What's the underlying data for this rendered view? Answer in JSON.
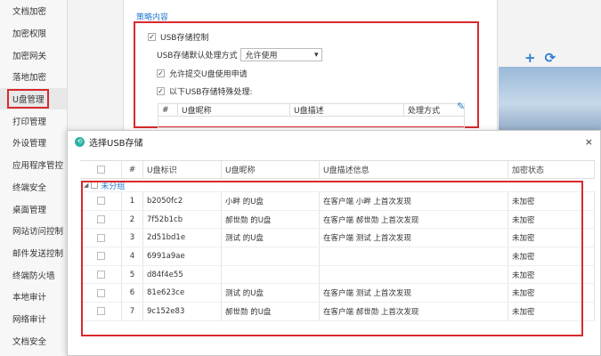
{
  "sidebar": {
    "items": [
      {
        "label": "文档加密"
      },
      {
        "label": "加密权限"
      },
      {
        "label": "加密网关"
      },
      {
        "label": "落地加密"
      },
      {
        "label": "U盘管理"
      },
      {
        "label": "打印管理"
      },
      {
        "label": "外设管理"
      },
      {
        "label": "应用程序管控"
      },
      {
        "label": "终端安全"
      },
      {
        "label": "桌面管理"
      },
      {
        "label": "网站访问控制"
      },
      {
        "label": "邮件发送控制"
      },
      {
        "label": "终端防火墙"
      },
      {
        "label": "本地审计"
      },
      {
        "label": "网络审计"
      },
      {
        "label": "文档安全"
      }
    ],
    "active_index": 4
  },
  "policy": {
    "section_title": "策略内容",
    "usb_control_label": "USB存储控制",
    "default_mode_label": "USB存储默认处理方式",
    "default_mode_value": "允许使用",
    "allow_request_label": "允许提交U盘使用申请",
    "special_label": "以下USB存储特殊处理:",
    "table_headers": [
      "#",
      "U盘昵称",
      "U盘描述",
      "处理方式"
    ]
  },
  "dialog": {
    "title": "选择USB存储",
    "close_glyph": "×",
    "headers": [
      "#",
      "U盘标识",
      "U盘昵称",
      "U盘描述信息",
      "加密状态"
    ],
    "group_label": "未分组",
    "rows": [
      {
        "num": "1",
        "id": "b2050fc2",
        "nick": "小畔 的U盘",
        "desc": "在客户端 小畔 上首次发现",
        "status": "未加密"
      },
      {
        "num": "2",
        "id": "7f52b1cb",
        "nick": "郝世勋 的U盘",
        "desc": "在客户端 郝世勋 上首次发现",
        "status": "未加密"
      },
      {
        "num": "3",
        "id": "2d51bd1e",
        "nick": "测试 的U盘",
        "desc": "在客户端 测试 上首次发现",
        "status": "未加密"
      },
      {
        "num": "4",
        "id": "6991a9ae",
        "nick": "",
        "desc": "",
        "status": "未加密"
      },
      {
        "num": "5",
        "id": "d84f4e55",
        "nick": "",
        "desc": "",
        "status": "未加密"
      },
      {
        "num": "6",
        "id": "81e623ce",
        "nick": "测试 的U盘",
        "desc": "在客户端 测试 上首次发现",
        "status": "未加密"
      },
      {
        "num": "7",
        "id": "9c152e83",
        "nick": "郝世勋 的U盘",
        "desc": "在客户端 郝世勋 上首次发现",
        "status": "未加密"
      }
    ]
  },
  "toolbar": {
    "add_icon": "plus-icon",
    "refresh_icon": "refresh-icon"
  },
  "colors": {
    "accent": "#2a7bd2",
    "highlight": "#d9292e"
  }
}
